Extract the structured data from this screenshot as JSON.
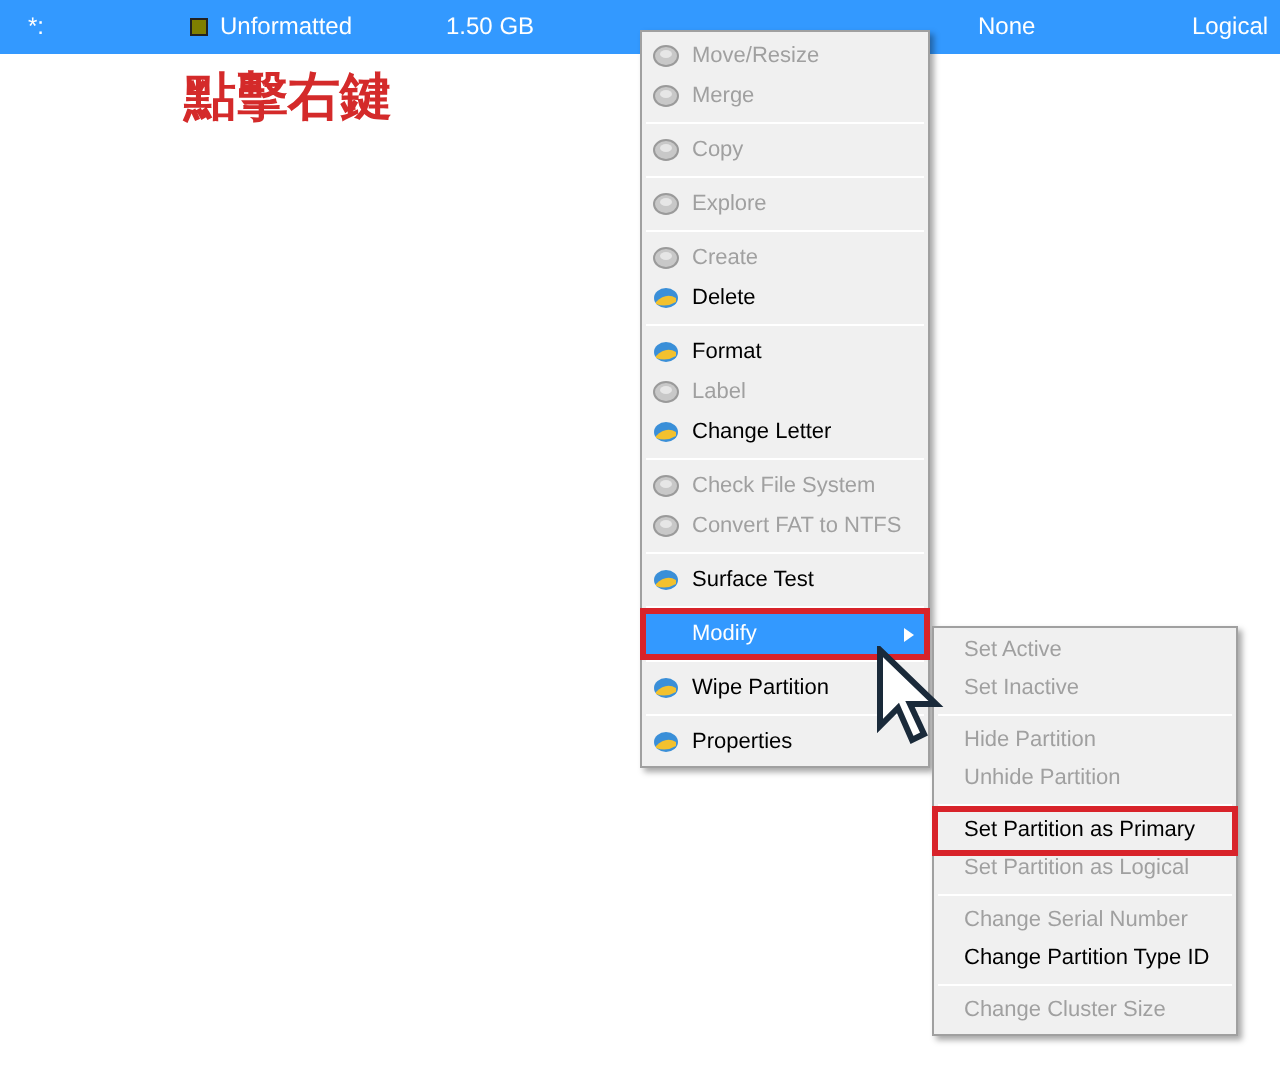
{
  "partition_row": {
    "selected": true,
    "cells": [
      "*:",
      "Unformatted",
      "1.50 GB",
      "None",
      "Logical"
    ]
  },
  "annotation": "點擊右鍵",
  "context_menu": {
    "groups": [
      [
        {
          "label": "Move/Resize",
          "disabled": true
        },
        {
          "label": "Merge",
          "disabled": true
        }
      ],
      [
        {
          "label": "Copy",
          "disabled": true
        }
      ],
      [
        {
          "label": "Explore",
          "disabled": true
        }
      ],
      [
        {
          "label": "Create",
          "disabled": true
        },
        {
          "label": "Delete",
          "disabled": false
        }
      ],
      [
        {
          "label": "Format",
          "disabled": false
        },
        {
          "label": "Label",
          "disabled": true
        },
        {
          "label": "Change Letter",
          "disabled": false
        }
      ],
      [
        {
          "label": "Check File System",
          "disabled": true
        },
        {
          "label": "Convert FAT to NTFS",
          "disabled": true
        }
      ],
      [
        {
          "label": "Surface Test",
          "disabled": false
        }
      ],
      [
        {
          "label": "Modify",
          "disabled": false,
          "selected": true,
          "highlighted": true,
          "submenu": true
        }
      ],
      [
        {
          "label": "Wipe Partition",
          "disabled": false
        }
      ],
      [
        {
          "label": "Properties",
          "disabled": false
        }
      ]
    ]
  },
  "submenu": {
    "groups": [
      [
        {
          "label": "Set Active",
          "disabled": true,
          "highlighted": false
        },
        {
          "label": "Set Inactive",
          "disabled": true,
          "highlighted": false
        }
      ],
      [
        {
          "label": "Hide Partition",
          "disabled": true,
          "highlighted": false
        },
        {
          "label": "Unhide Partition",
          "disabled": true,
          "highlighted": false
        }
      ],
      [
        {
          "label": "Set Partition as Primary",
          "disabled": false,
          "highlighted": true
        },
        {
          "label": "Set Partition as Logical",
          "disabled": true,
          "highlighted": false
        }
      ],
      [
        {
          "label": "Change Serial Number",
          "disabled": true,
          "highlighted": false
        },
        {
          "label": "Change Partition Type ID",
          "disabled": false,
          "highlighted": false
        }
      ],
      [
        {
          "label": "Change Cluster Size",
          "disabled": true,
          "highlighted": false
        }
      ]
    ]
  }
}
